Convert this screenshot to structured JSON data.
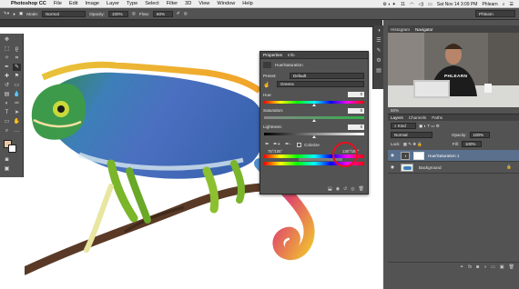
{
  "menubar": {
    "app_name": "Photoshop CC",
    "items": [
      "File",
      "Edit",
      "Image",
      "Layer",
      "Type",
      "Select",
      "Filter",
      "3D",
      "View",
      "Window",
      "Help"
    ],
    "status_num": "11",
    "clock": "Sat Nov 14  3:09 PM",
    "user": "Phlearn"
  },
  "options": {
    "mode_label": "Mode:",
    "mode_value": "Normal",
    "opacity_label": "Opacity:",
    "opacity_value": "100%",
    "flow_label": "Flow:",
    "flow_value": "60%",
    "workspace": "Phlearn"
  },
  "properties": {
    "tabs": [
      "Properties",
      "Info"
    ],
    "adjustment_title": "Hue/Saturation",
    "preset_label": "Preset:",
    "preset_value": "Default",
    "channel_value": "Greens",
    "hue_label": "Hue:",
    "hue_value": "0",
    "saturation_label": "Saturation:",
    "saturation_value": "0",
    "lightness_label": "Lightness:",
    "lightness_value": "0",
    "colorize_label": "Colorize",
    "range_left": "75°/105°",
    "range_right": "135°/165°"
  },
  "navigator": {
    "tabs": [
      "Histogram",
      "Navigator"
    ],
    "zoom": "50%",
    "shirt_text": "PHLEARN"
  },
  "layers": {
    "tabs": [
      "Layers",
      "Channels",
      "Paths"
    ],
    "kind_label": "Kind",
    "blend_mode": "Normal",
    "opacity_label": "Opacity:",
    "opacity_value": "100%",
    "lock_label": "Lock:",
    "fill_label": "Fill:",
    "fill_value": "100%",
    "items": [
      {
        "name": "Hue/Saturation 1",
        "selected": true
      },
      {
        "name": "Background",
        "selected": false
      }
    ]
  },
  "colors": {
    "panel": "#535353",
    "panel_dark": "#424242",
    "selection": "#5a708c",
    "annotation_red": "#e8101a"
  }
}
